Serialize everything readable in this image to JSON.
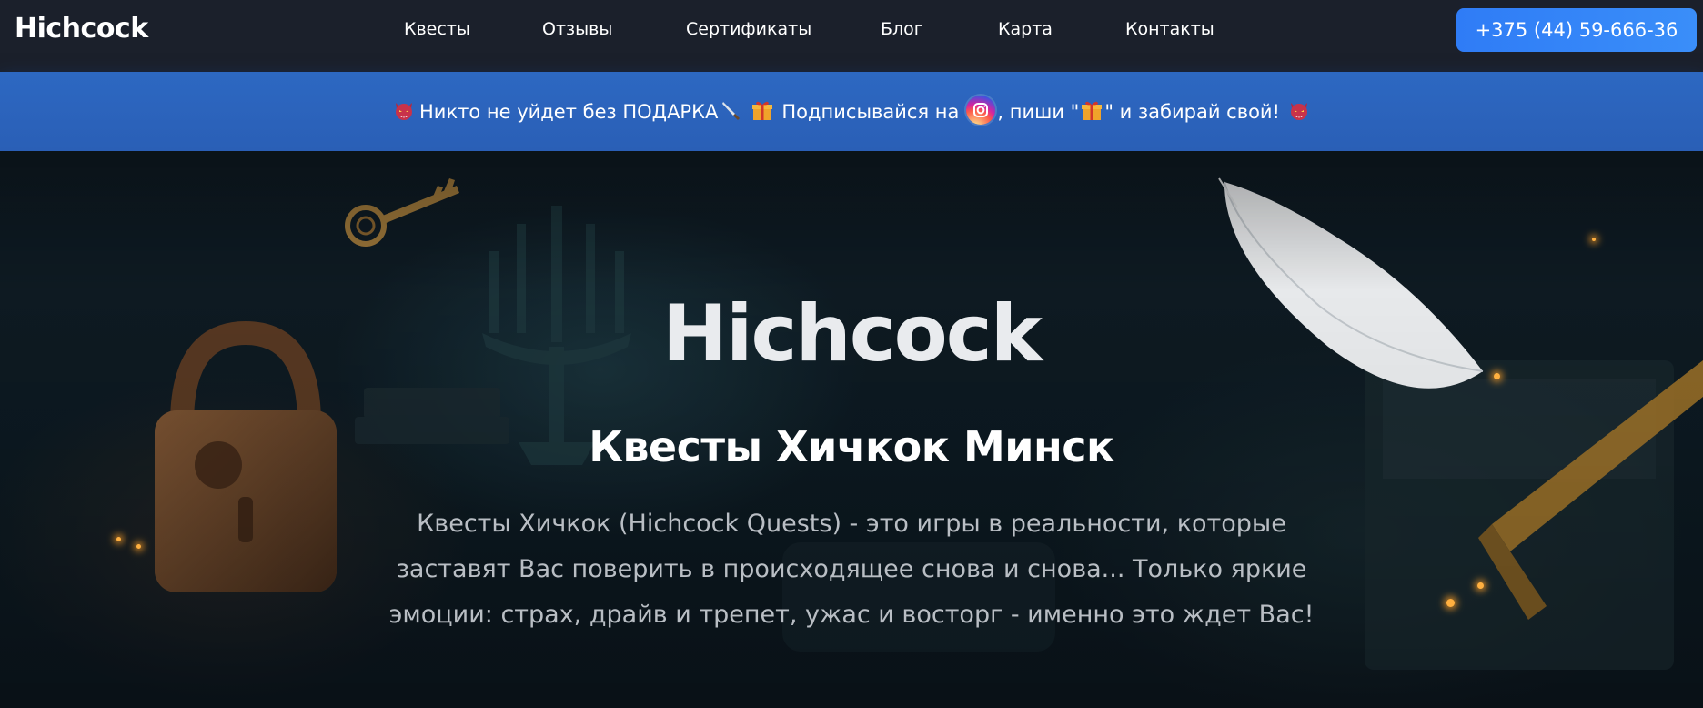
{
  "header": {
    "logo": "Hichcock",
    "nav": [
      {
        "label": "Квесты"
      },
      {
        "label": "Отзывы"
      },
      {
        "label": "Сертификаты"
      },
      {
        "label": "Блог"
      },
      {
        "label": "Карта"
      },
      {
        "label": "Контакты"
      }
    ],
    "phone": "+375 (44) 59-666-36"
  },
  "banner": {
    "text_1": "Никто не уйдет без ПОДАРКА",
    "text_2": "Подписывайся на",
    "text_3": ", пиши \"",
    "text_4": "\" и забирай свой!",
    "icons": [
      "devil-icon",
      "knife-icon",
      "gift-icon",
      "instagram-icon",
      "gift-icon",
      "devil-icon"
    ]
  },
  "hero": {
    "logo": "Hichcock",
    "title": "Квесты Хичкок Минск",
    "description": "Квесты Хичкок (Hichcock Quests) - это игры в реальности, которые заставят Вас поверить в происходящее снова и снова... Только яркие эмоции: страх, драйв и трепет, ужас и восторг - именно это ждет Вас!"
  },
  "colors": {
    "header_bg": "#1b202b",
    "banner_bg": "#2d68c2",
    "phone_button": "#2f7cf6",
    "hero_bg": "#0d1a22"
  }
}
